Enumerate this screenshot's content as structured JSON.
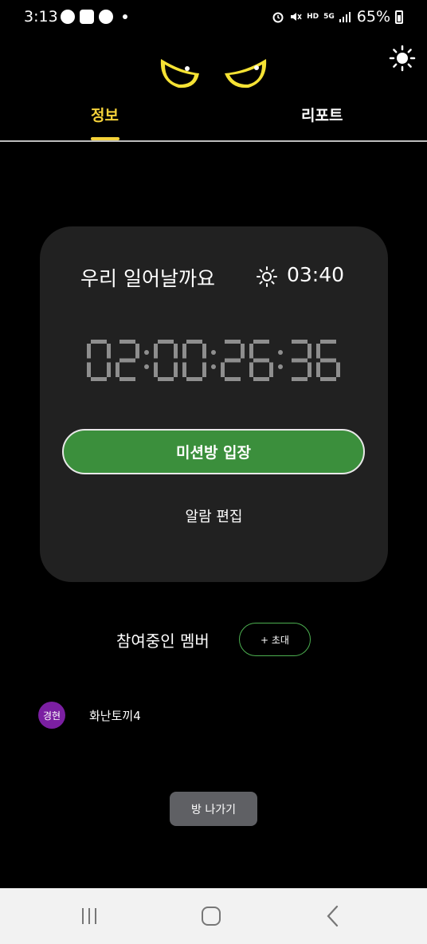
{
  "status": {
    "time": "3:13",
    "battery_percent": "65%",
    "hd_label": "HD",
    "network_label": "5G"
  },
  "icons": {
    "theme_toggle": "sun-icon",
    "alarm_sun": "sun-icon"
  },
  "tabs": [
    {
      "label": "정보",
      "active": true
    },
    {
      "label": "리포트",
      "active": false
    }
  ],
  "card": {
    "alarm_name": "우리 일어날까요",
    "alarm_time": "03:40",
    "countdown": "02:00:26:36",
    "mission_button": "미션방 입장",
    "edit_alarm": "알람 편집"
  },
  "members": {
    "title": "참여중인 멤버",
    "invite_button": "+ 초대",
    "list": [
      {
        "avatar_text": "경현",
        "name": "화난토끼4"
      }
    ]
  },
  "leave_button": "방 나가기",
  "colors": {
    "accent_yellow": "#f5d23a",
    "mission_green": "#3b8f3c",
    "card_bg": "#212121",
    "avatar_purple": "#7b1fa2"
  }
}
